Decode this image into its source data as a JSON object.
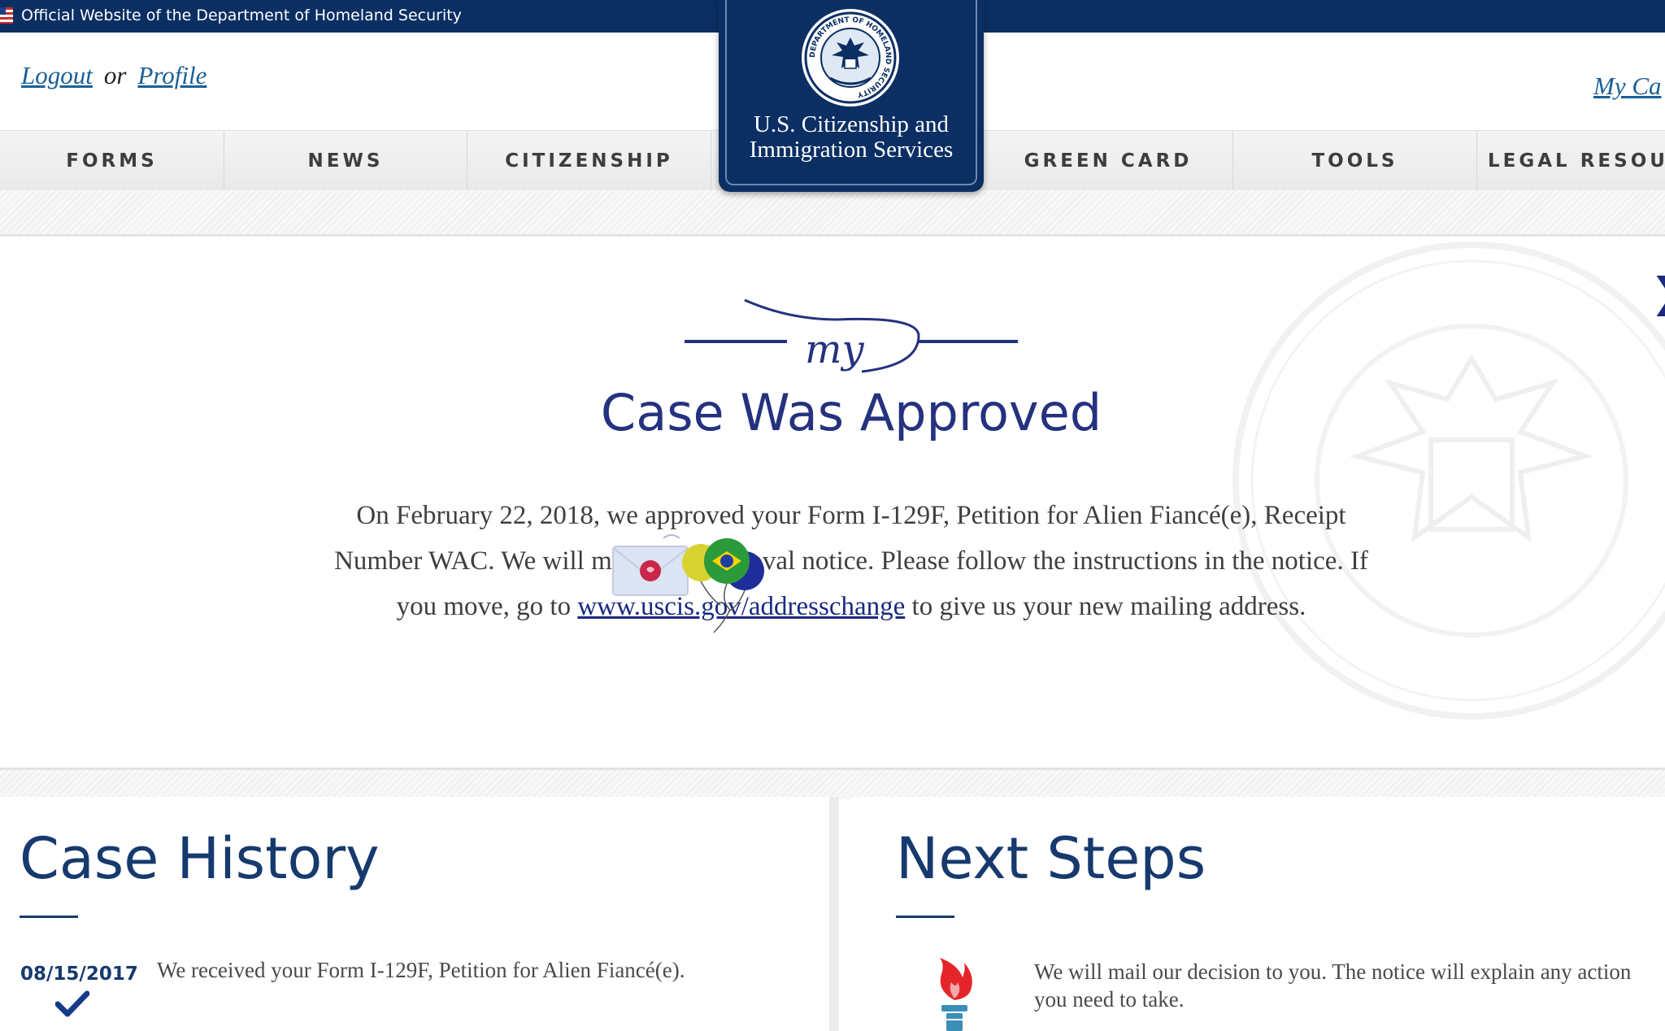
{
  "banner": {
    "text": "Official Website of the Department of Homeland Security"
  },
  "utility": {
    "logout": "Logout",
    "or": "or",
    "profile": "Profile",
    "my_case": "My Ca"
  },
  "logo": {
    "seal_text": "DEPARTMENT OF HOMELAND SECURITY",
    "seal_us": "U.S.",
    "line1": "U.S. Citizenship and",
    "line2": "Immigration Services"
  },
  "nav": [
    "FORMS",
    "NEWS",
    "CITIZENSHIP",
    "GREEN CARD",
    "TOOLS",
    "LEGAL RESOUR"
  ],
  "status": {
    "my_logo": "my",
    "title": "Case Was Approved",
    "body_pre": "On February 22, 2018, we approved your Form I-129F, Petition for Alien Fiancé(e), Receipt Number WAC",
    "body_mid": ". We will mail your approval notice. Please follow the instructions in the notice. If you move, go to ",
    "link_text": "www.uscis.gov/addresschange",
    "body_post": " to give us your new mailing address.",
    "next_arrow": "❯"
  },
  "history": {
    "title": "Case History",
    "items": [
      {
        "date": "08/15/2017",
        "text": "We received your Form I-129F, Petition for Alien Fiancé(e)."
      }
    ]
  },
  "next_steps": {
    "title": "Next Steps",
    "text": "We will mail our decision to you. The notice will explain any action you need to take."
  },
  "colors": {
    "navy": "#0b2f63",
    "title_blue": "#24327f",
    "heading_blue": "#163a6e",
    "link_blue": "#1a5f97"
  },
  "icons": [
    "flag-icon",
    "dhs-seal-icon",
    "chevron-right-icon",
    "checkmark-icon",
    "torch-icon",
    "envelope-sticker",
    "balloon-sticker"
  ]
}
